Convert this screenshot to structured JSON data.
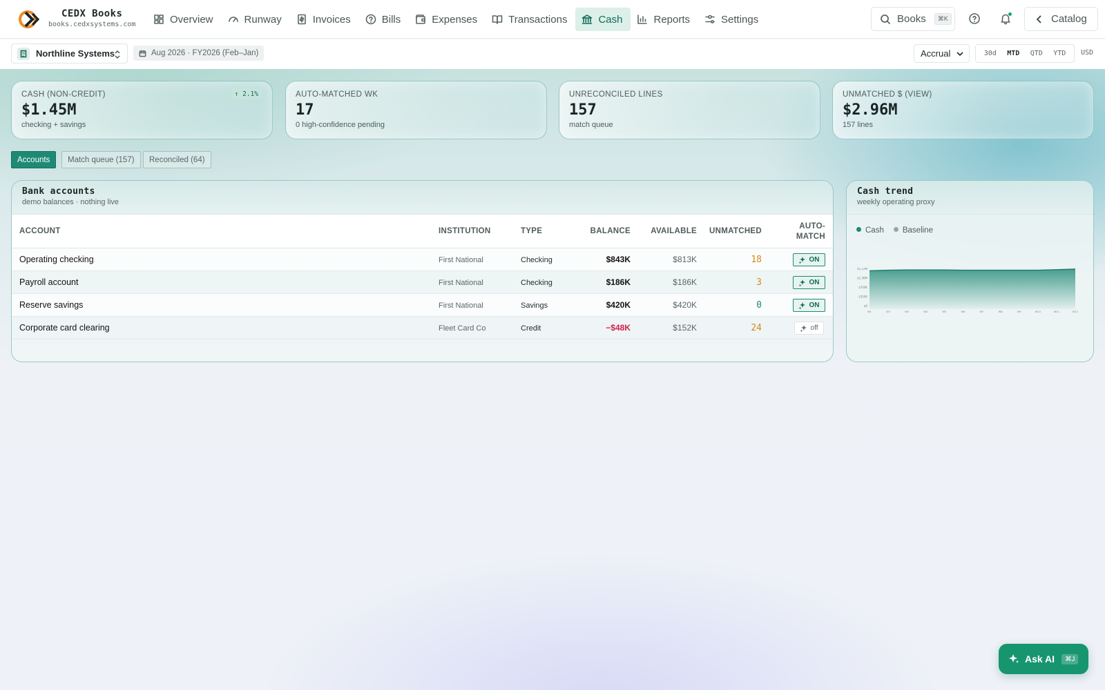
{
  "app": {
    "name": "CEDX Books",
    "domain": "books.cedxsystems.com"
  },
  "nav": {
    "items": [
      {
        "label": "Overview",
        "icon": "grid-icon"
      },
      {
        "label": "Runway",
        "icon": "gauge-icon"
      },
      {
        "label": "Invoices",
        "icon": "invoice-icon"
      },
      {
        "label": "Bills",
        "icon": "help-circle-icon"
      },
      {
        "label": "Expenses",
        "icon": "wallet-icon"
      },
      {
        "label": "Transactions",
        "icon": "book-icon"
      },
      {
        "label": "Cash",
        "icon": "bank-icon",
        "active": true
      },
      {
        "label": "Reports",
        "icon": "bar-chart-icon"
      },
      {
        "label": "Settings",
        "icon": "sliders-icon"
      }
    ],
    "search_label": "Books",
    "search_shortcut": "⌘K",
    "catalog_label": "Catalog"
  },
  "subbar": {
    "company": "Northline Systems",
    "period": "Aug 2026 · FY2026 (Feb–Jan)",
    "basis": "Accrual",
    "ranges": [
      "30d",
      "MTD",
      "QTD",
      "YTD"
    ],
    "active_range": "MTD",
    "currency": "USD"
  },
  "kpis": [
    {
      "label": "Cash (non-credit)",
      "value": "$1.45M",
      "sub": "checking + savings",
      "delta": "↑ 2.1%"
    },
    {
      "label": "Auto-matched wk",
      "value": "17",
      "sub": "0 high-confidence pending"
    },
    {
      "label": "Unreconciled lines",
      "value": "157",
      "sub": "match queue"
    },
    {
      "label": "Unmatched $ (view)",
      "value": "$2.96M",
      "sub": "157 lines"
    }
  ],
  "tabs": [
    {
      "label": "Accounts",
      "active": true
    },
    {
      "label": "Match queue (157)"
    },
    {
      "label": "Reconciled (64)"
    }
  ],
  "bank_accounts": {
    "title": "Bank accounts",
    "subtitle": "demo balances · nothing live",
    "columns": {
      "account": "ACCOUNT",
      "institution": "INSTITUTION",
      "type": "TYPE",
      "balance": "BALANCE",
      "available": "AVAILABLE",
      "unmatched": "UNMATCHED",
      "auto_match_1": "AUTO-",
      "auto_match_2": "MATCH"
    },
    "rows": [
      {
        "account": "Operating checking",
        "institution": "First National",
        "type": "Checking",
        "balance": "$843K",
        "available": "$813K",
        "unmatched": "18",
        "auto": "ON"
      },
      {
        "account": "Payroll account",
        "institution": "First National",
        "type": "Checking",
        "balance": "$186K",
        "available": "$186K",
        "unmatched": "3",
        "auto": "ON"
      },
      {
        "account": "Reserve savings",
        "institution": "First National",
        "type": "Savings",
        "balance": "$420K",
        "available": "$420K",
        "unmatched": "0",
        "auto": "ON"
      },
      {
        "account": "Corporate card clearing",
        "institution": "Fleet Card Co",
        "type": "Credit",
        "balance": "−$48K",
        "available": "$152K",
        "unmatched": "24",
        "auto": "off"
      }
    ]
  },
  "cash_trend": {
    "title": "Cash trend",
    "subtitle": "weekly operating proxy",
    "legend": [
      {
        "label": "Cash",
        "color": "#1f8a74"
      },
      {
        "label": "Baseline",
        "color": "#9aa4a8"
      }
    ]
  },
  "chart_data": {
    "type": "area",
    "x": [
      "W1",
      "W2",
      "W3",
      "W4",
      "W5",
      "W6",
      "W7",
      "W8",
      "W9",
      "W10",
      "W11",
      "W12"
    ],
    "series": [
      {
        "name": "Cash",
        "values": [
          1.39,
          1.41,
          1.42,
          1.42,
          1.42,
          1.41,
          1.41,
          1.41,
          1.41,
          1.41,
          1.43,
          1.45
        ]
      }
    ],
    "y_ticks": [
      "$1.12M",
      "$1.40M",
      "$700K",
      "$350K",
      "$0"
    ],
    "ylim": [
      0,
      1.5
    ],
    "grid": false,
    "legend": "top-left"
  },
  "ask_ai": {
    "label": "Ask AI",
    "shortcut": "⌘J"
  },
  "colors": {
    "accent": "#1f8a74",
    "warning": "#d58a1a",
    "negative": "#d1204b"
  }
}
